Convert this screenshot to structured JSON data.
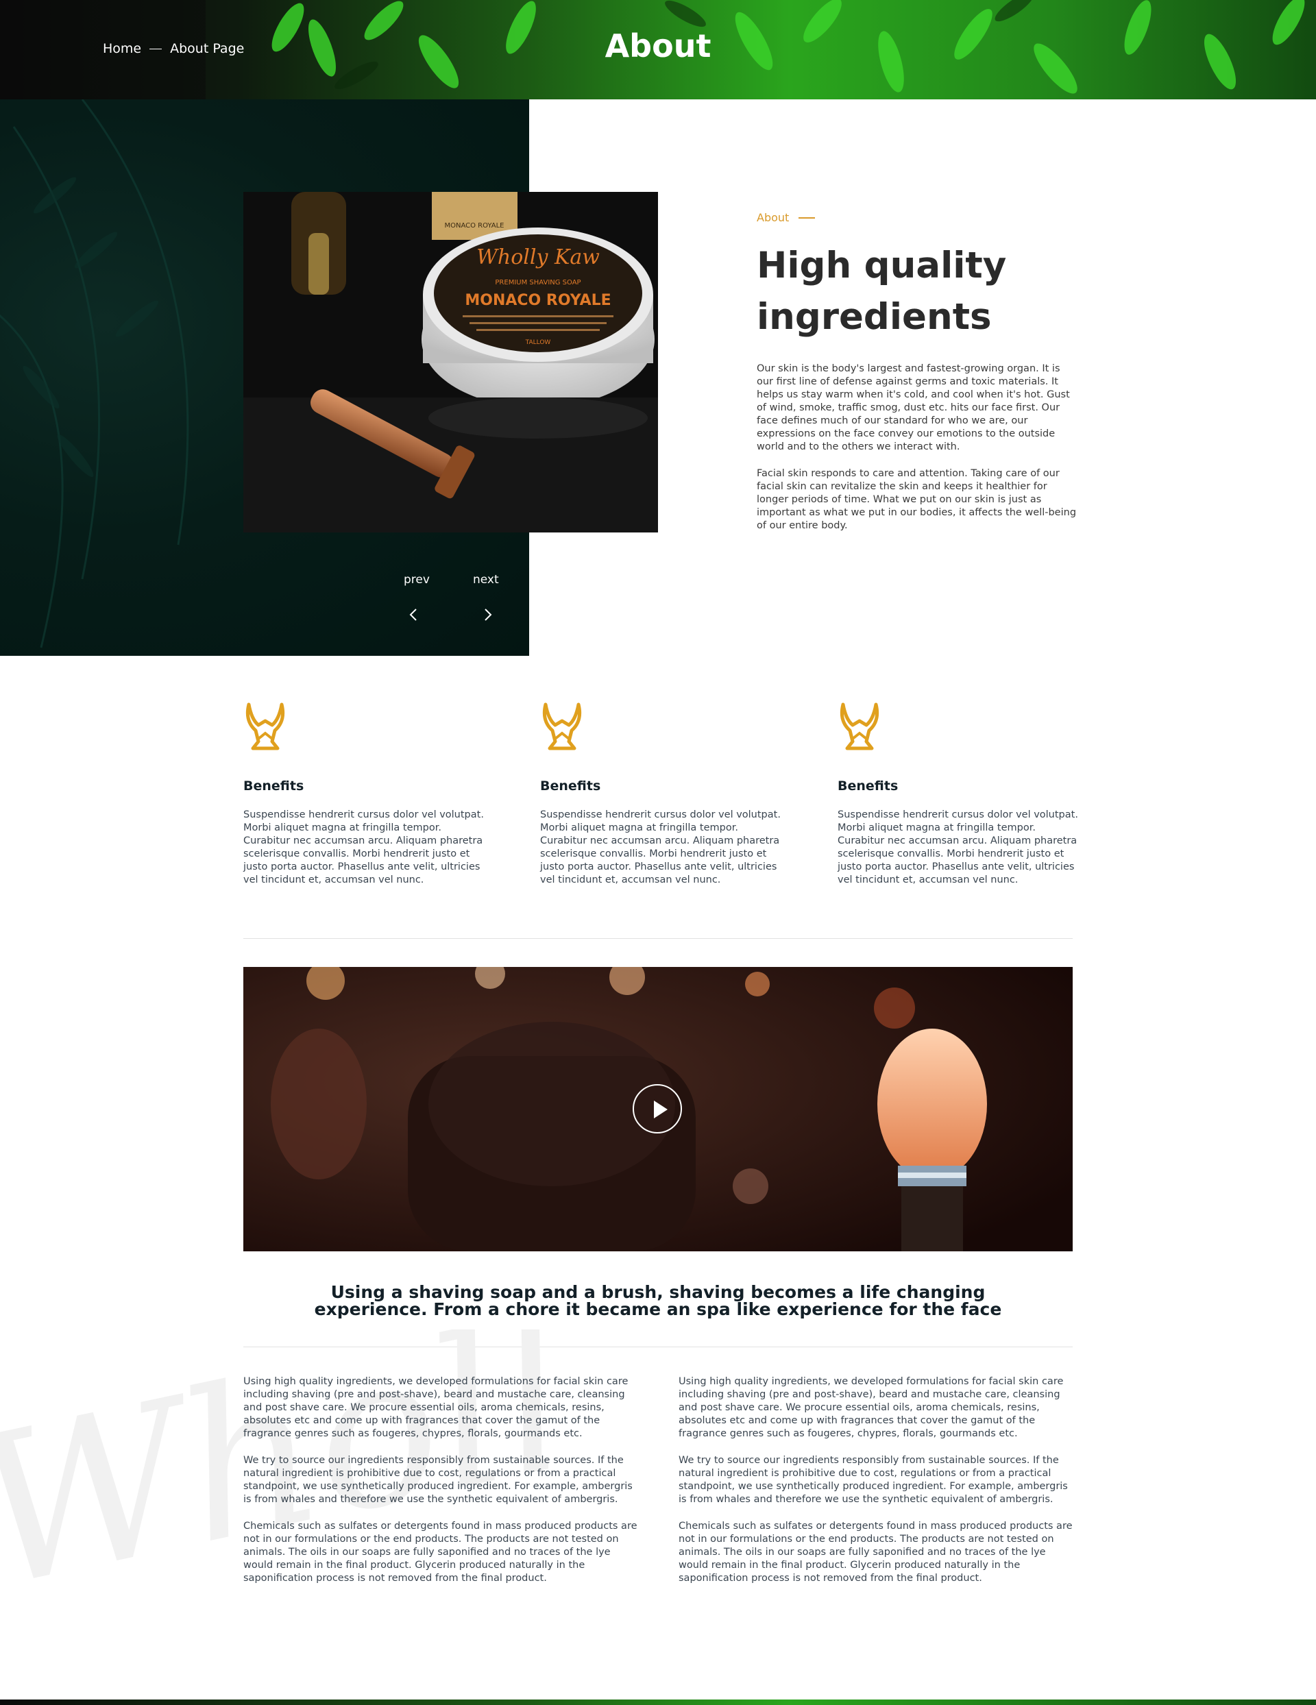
{
  "breadcrumb": {
    "home": "Home",
    "current": "About Page"
  },
  "hero": {
    "title": "About"
  },
  "slider": {
    "prev_label": "prev",
    "next_label": "next"
  },
  "about": {
    "tag": "About",
    "heading": "High quality ingredients",
    "paragraphs": [
      "Our skin is the body's largest and fastest-growing organ. It is our first line of defense against germs and toxic materials. It helps us stay warm when it's cold, and cool when it's hot. Gust of wind, smoke, traffic smog, dust etc. hits our face first. Our face defines much of our standard for who we are, our expressions on the face convey our emotions to the outside world and to the others we interact with.",
      "Facial skin responds to care and attention. Taking care of our facial skin can revitalize the skin and keeps it healthier for longer periods of time. What we put on our skin is just as important as what we put in our bodies, it affects the well-being of our entire body."
    ]
  },
  "product": {
    "brand": "Wholly Kaw",
    "line": "PREMIUM SHAVING SOAP",
    "name": "MONACO ROYALE",
    "base": "TALLOW",
    "jar_label": "MONACO ROYALE"
  },
  "benefits": [
    {
      "title": "Benefits",
      "text": "Suspendisse hendrerit cursus dolor vel volutpat. Morbi aliquet magna at fringilla tempor. Curabitur nec accumsan arcu. Aliquam pharetra scelerisque convallis. Morbi hendrerit justo et justo porta auctor. Phasellus ante velit, ultricies vel tincidunt et, accumsan vel nunc."
    },
    {
      "title": "Benefits",
      "text": "Suspendisse hendrerit cursus dolor vel volutpat. Morbi aliquet magna at fringilla tempor. Curabitur nec accumsan arcu. Aliquam pharetra scelerisque convallis. Morbi hendrerit justo et justo porta auctor. Phasellus ante velit, ultricies vel tincidunt et, accumsan vel nunc."
    },
    {
      "title": "Benefits",
      "text": "Suspendisse hendrerit cursus dolor vel volutpat. Morbi aliquet magna at fringilla tempor. Curabitur nec accumsan arcu. Aliquam pharetra scelerisque convallis. Morbi hendrerit justo et justo porta auctor. Phasellus ante velit, ultricies vel tincidunt et, accumsan vel nunc."
    }
  ],
  "video": {
    "icon": "play-icon"
  },
  "quote": "Using a shaving soap and a brush, shaving becomes a life changing experience. From a chore it became an spa like experience for the face",
  "columns": {
    "left": [
      "Using high quality ingredients, we developed formulations for facial skin care including shaving (pre and post-shave), beard and mustache care, cleansing and post shave care. We procure essential oils, aroma chemicals, resins, absolutes etc and come up with fragrances that cover the gamut of the fragrance genres such as fougeres, chypres, florals, gourmands etc.",
      "We try to source our ingredients responsibly from sustainable sources. If the natural ingredient is prohibitive due to cost, regulations or from a practical standpoint, we use synthetically produced ingredient. For example, ambergris is from whales and therefore we use the synthetic equivalent of ambergris.",
      "Chemicals such as sulfates or detergents found in mass produced products are not in our formulations or the end products. The products are not tested on animals. The oils in our soaps are fully saponified and no traces of the lye would remain in the final product. Glycerin produced naturally in the saponification process is not removed from the final product."
    ],
    "right": [
      "Using high quality ingredients, we developed formulations for facial skin care including shaving (pre and post-shave), beard and mustache care, cleansing and post shave care. We procure essential oils, aroma chemicals, resins, absolutes etc and come up with fragrances that cover the gamut of the fragrance genres such as fougeres, chypres, florals, gourmands etc.",
      "We try to source our ingredients responsibly from sustainable sources. If the natural ingredient is prohibitive due to cost, regulations or from a practical standpoint, we use synthetically produced ingredient. For example, ambergris is from whales and therefore we use the synthetic equivalent of ambergris.",
      "Chemicals such as sulfates or detergents found in mass produced products are not in our formulations or the end products. The products are not tested on animals. The oils in our soaps are fully saponified and no traces of the lye would remain in the final product. Glycerin produced naturally in the saponification process is not removed from the final product."
    ]
  },
  "watermark": "Wholly Kaw",
  "colors": {
    "accent": "#d99a2b",
    "dark_panel": "#061c18",
    "heading": "#2b2b2b",
    "leaf_green": "#2aa51d"
  }
}
